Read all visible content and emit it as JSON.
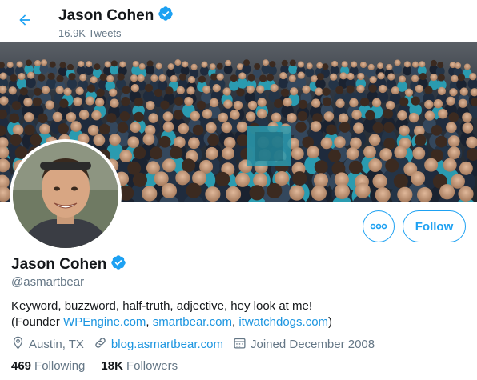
{
  "header": {
    "name": "Jason Cohen",
    "tweet_count": "16.9K Tweets"
  },
  "profile": {
    "name": "Jason Cohen",
    "handle": "@asmartbear",
    "bio_line1": "Keyword, buzzword, half-truth, adjective, hey look at me!",
    "bio_prefix": "(Founder ",
    "bio_link1": "WPEngine.com",
    "bio_sep1": ", ",
    "bio_link2": "smartbear.com",
    "bio_sep2": ", ",
    "bio_link3": "itwatchdogs.com",
    "bio_suffix": ")",
    "location": "Austin, TX",
    "website": "blog.asmartbear.com",
    "joined": "Joined December 2008"
  },
  "stats": {
    "following_count": "469",
    "following_label": "Following",
    "followers_count": "18K",
    "followers_label": "Followers"
  },
  "actions": {
    "more_label": "ooo",
    "follow_label": "Follow"
  },
  "colors": {
    "accent": "#1da1f2",
    "link": "#1b95e0",
    "muted": "#657786"
  }
}
